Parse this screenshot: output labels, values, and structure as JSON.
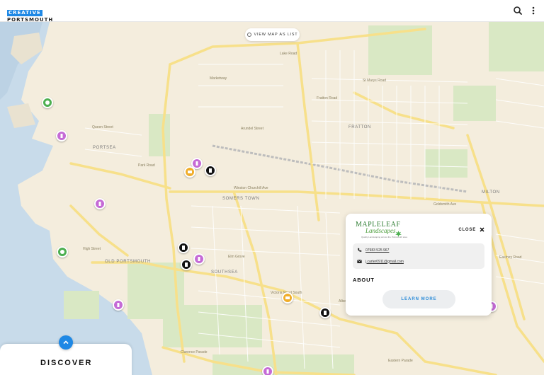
{
  "header": {
    "logo_top": "CREATIVE",
    "logo_bottom": "PORTSMOUTH",
    "search_icon": "search-icon",
    "menu_icon": "more-vertical-icon"
  },
  "map": {
    "view_list_label": "VIEW MAP AS LIST",
    "areas": [
      "PORTSEA",
      "SOMERS TOWN",
      "FRATTON",
      "MILTON",
      "OLD PORTSMOUTH",
      "SOUTHSEA"
    ],
    "roads": [
      "Marketway",
      "Lake Road",
      "Queen Street",
      "Arundel Street",
      "Park Road",
      "Winston Churchill Ave",
      "Goldsmith Ave",
      "Fratton Road",
      "Elm Grove",
      "High Street",
      "Clarence Parade",
      "Eastern Parade",
      "Albert Road",
      "St Marys Road",
      "Victoria Road South",
      "Eastney Road"
    ],
    "colors": {
      "land": "#f4eddd",
      "water": "#c8dbea",
      "park": "#d9e8c4",
      "road": "#f7e08a",
      "accent": "#1e88e5"
    }
  },
  "card": {
    "brand_main": "MAPLELEAF",
    "brand_sub": "Landscapes",
    "brand_tag": "Quality Landscaping across the Portsmouth area",
    "close_label": "CLOSE",
    "phone": "07983 525 967",
    "email": "j.carter0911@gmail.com",
    "about_label": "ABOUT",
    "learn_more_label": "LEARN MORE"
  },
  "discover": {
    "label": "DISCOVER"
  }
}
